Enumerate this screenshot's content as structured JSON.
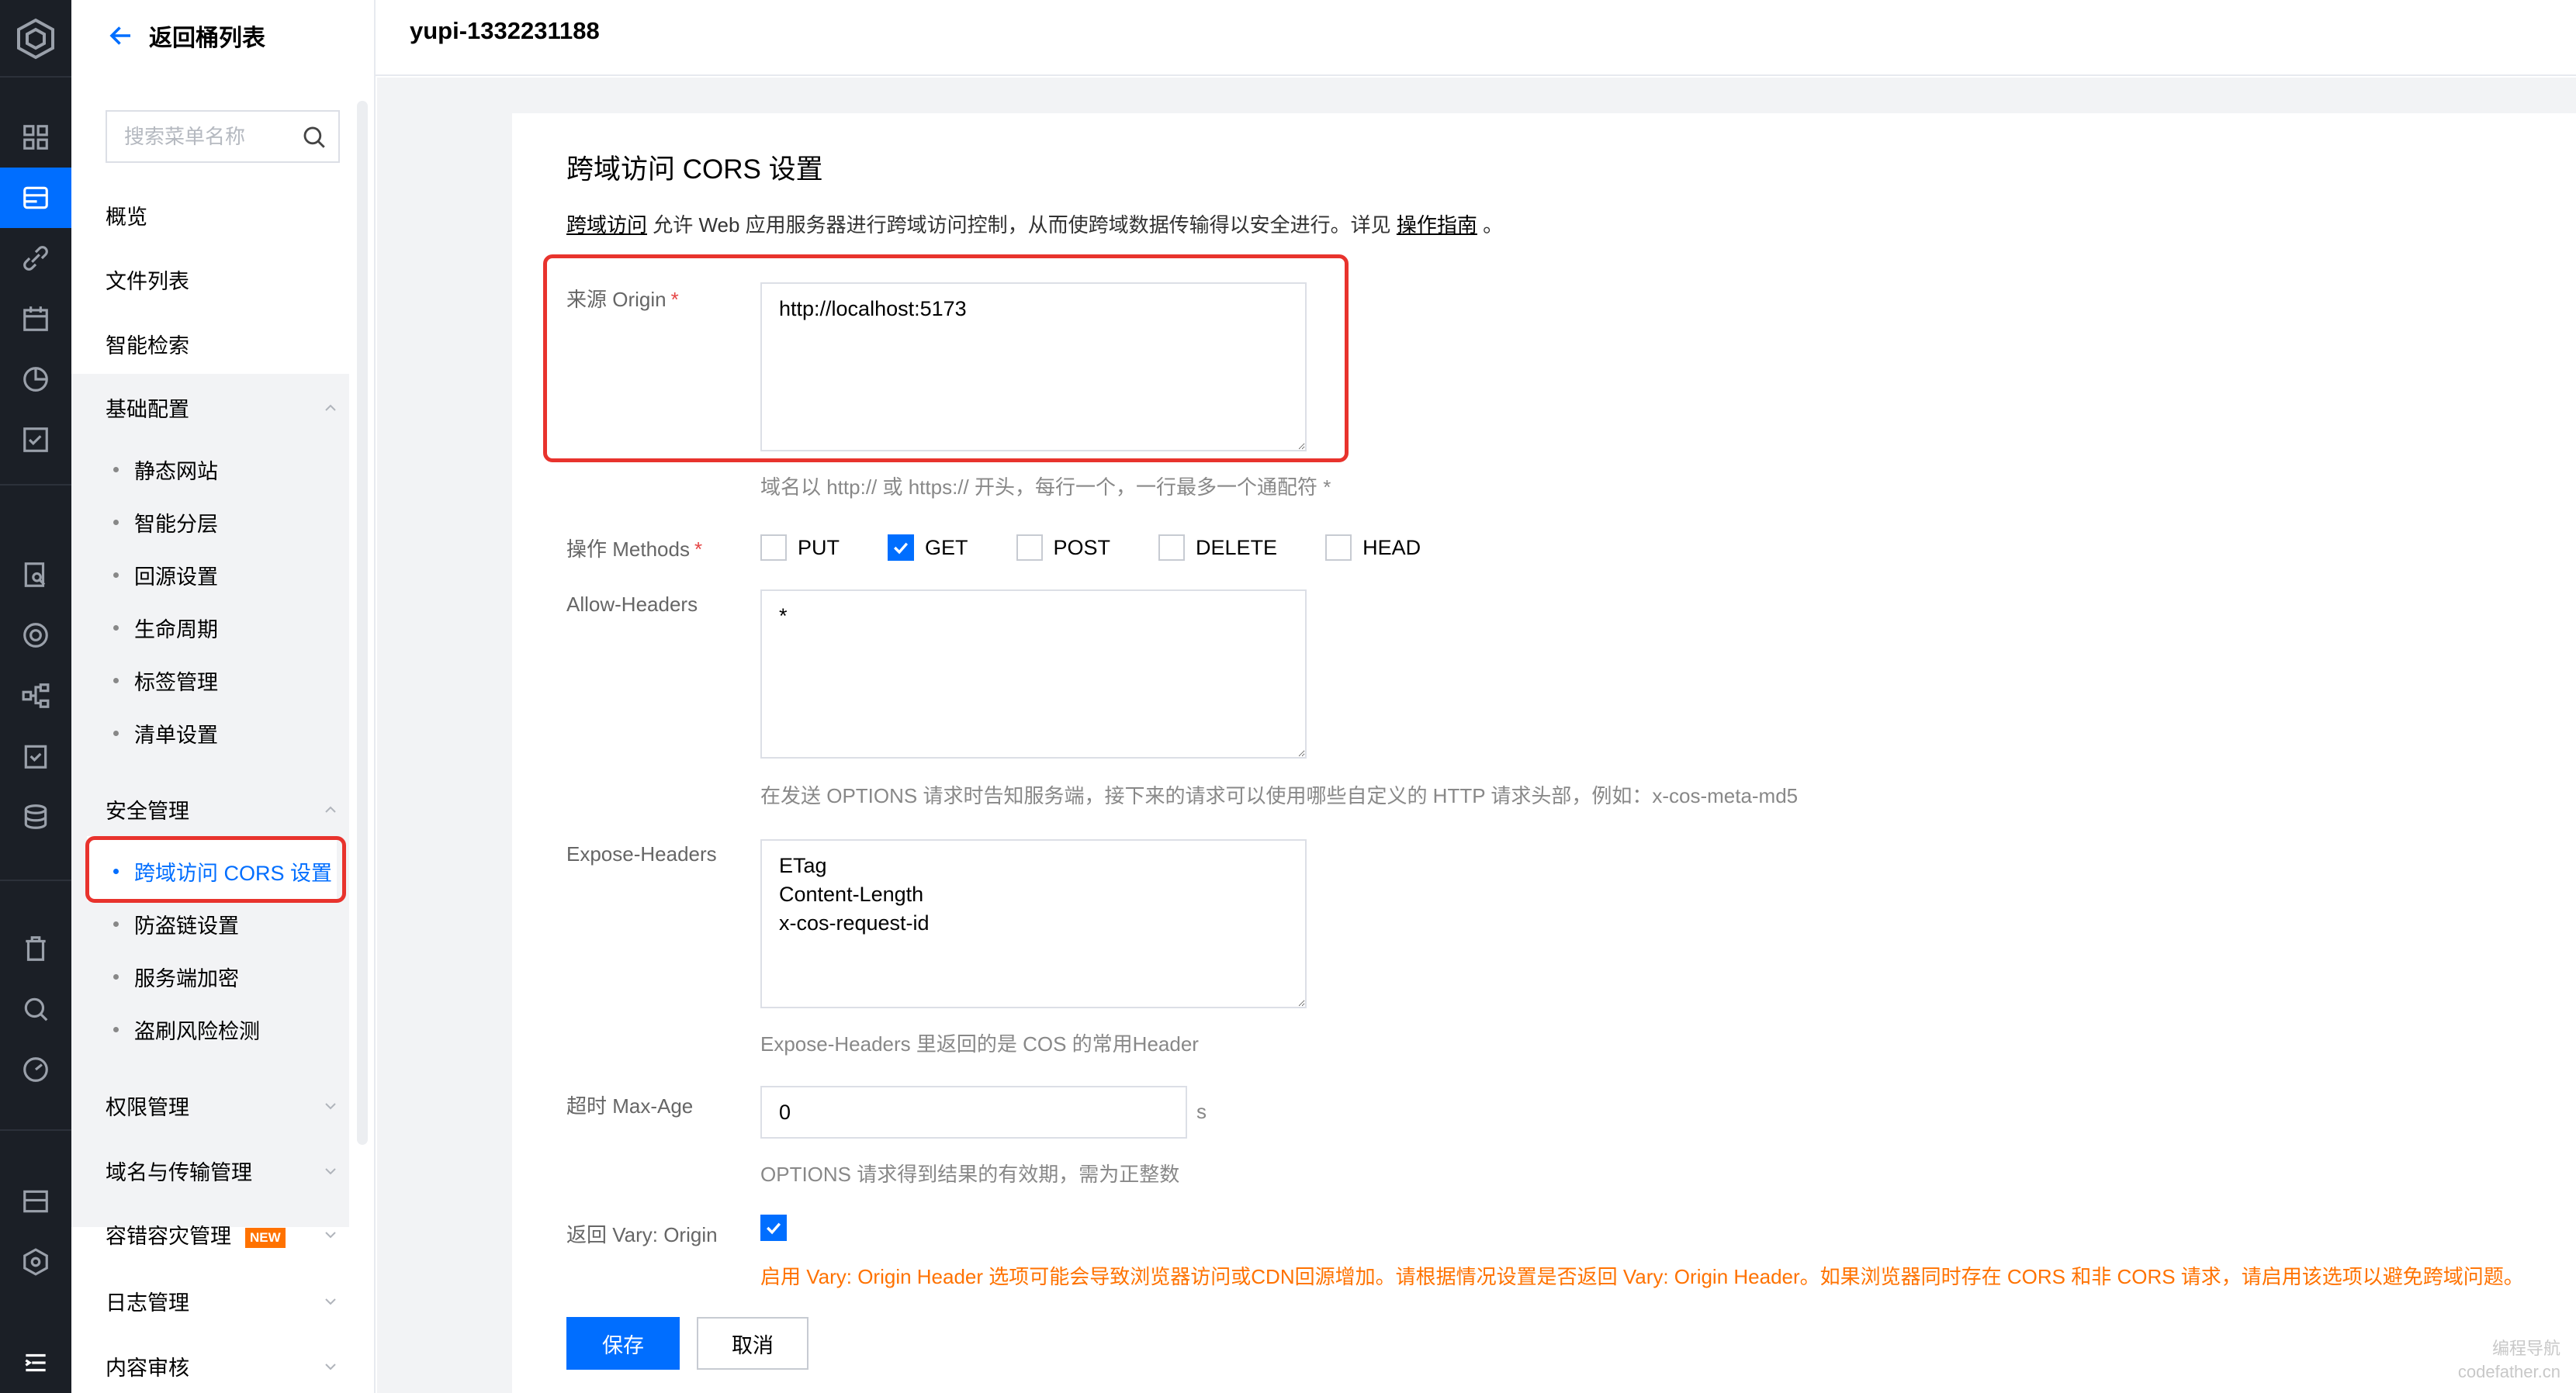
{
  "header": {
    "bucket_name": "yupi-1332231188"
  },
  "sidebar": {
    "back_label": "返回桶列表",
    "search_placeholder": "搜索菜单名称",
    "top_items": [
      "概览",
      "文件列表",
      "智能检索"
    ],
    "groups": [
      {
        "label": "基础配置",
        "items": [
          "静态网站",
          "智能分层",
          "回源设置",
          "生命周期",
          "标签管理",
          "清单设置"
        ]
      },
      {
        "label": "安全管理",
        "items": [
          "跨域访问 CORS 设置",
          "防盗链设置",
          "服务端加密",
          "盗刷风险检测"
        ]
      }
    ],
    "collapsed_groups": [
      "权限管理",
      "域名与传输管理",
      "容错容灾管理",
      "日志管理",
      "内容审核"
    ],
    "new_badge": "NEW",
    "active_item": "跨域访问 CORS 设置"
  },
  "rail_icons": [
    "cloud-logo-icon",
    "dashboard-icon",
    "bucket-icon",
    "link-icon",
    "calendar-icon",
    "pie-chart-icon",
    "checklist-icon",
    "file-search-icon",
    "monitor-icon",
    "topology-icon",
    "task-icon",
    "database-icon",
    "trash-icon",
    "search-icon",
    "gauge-icon",
    "database-settings-icon",
    "hexagon-icon",
    "expand-menu-icon"
  ],
  "page": {
    "title": "跨域访问 CORS 设置",
    "desc_link": "跨域访问",
    "desc_text": " 允许 Web 应用服务器进行跨域访问控制，从而使跨域数据传输得以安全进行。详见 ",
    "guide_link": "操作指南",
    "desc_end": " 。"
  },
  "form": {
    "origin": {
      "label": "来源 Origin",
      "required_mark": "*",
      "value": "http://localhost:5173",
      "hint": "域名以 http:// 或 https:// 开头，每行一个，一行最多一个通配符 *"
    },
    "methods": {
      "label": "操作 Methods",
      "required_mark": "*",
      "options": [
        {
          "label": "PUT",
          "checked": false
        },
        {
          "label": "GET",
          "checked": true
        },
        {
          "label": "POST",
          "checked": false
        },
        {
          "label": "DELETE",
          "checked": false
        },
        {
          "label": "HEAD",
          "checked": false
        }
      ]
    },
    "allow_headers": {
      "label": "Allow-Headers",
      "value": "*",
      "hint": "在发送 OPTIONS 请求时告知服务端，接下来的请求可以使用哪些自定义的 HTTP 请求头部，例如：x-cos-meta-md5"
    },
    "expose_headers": {
      "label": "Expose-Headers",
      "value": "ETag\nContent-Length\nx-cos-request-id",
      "hint": "Expose-Headers 里返回的是 COS 的常用Header"
    },
    "max_age": {
      "label": "超时 Max-Age",
      "value": "0",
      "unit": "s",
      "hint": "OPTIONS 请求得到结果的有效期，需为正整数"
    },
    "vary": {
      "label": "返回 Vary: Origin",
      "checked": true,
      "warning": "启用 Vary: Origin Header 选项可能会导致浏览器访问或CDN回源增加。请根据情况设置是否返回 Vary: Origin Header。如果浏览器同时存在 CORS 和非 CORS 请求，请启用该选项以避免跨域问题。"
    }
  },
  "buttons": {
    "save": "保存",
    "cancel": "取消"
  },
  "watermark": {
    "line1": "编程导航",
    "line2": "codefather.cn"
  },
  "colors": {
    "accent": "#006eff",
    "highlight_border": "#e8332d",
    "warning": "#ff7200",
    "rail_bg": "#1b1f26"
  }
}
